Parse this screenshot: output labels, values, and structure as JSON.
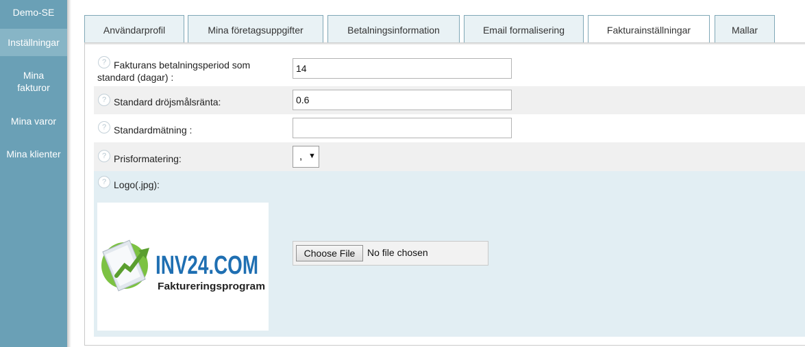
{
  "sidebar": {
    "title": "Demo-SE",
    "items": [
      {
        "label": "Inställningar",
        "active": true
      },
      {
        "label": "Mina fakturor",
        "active": false
      },
      {
        "label": "Mina varor",
        "active": false
      },
      {
        "label": "Mina klienter",
        "active": false
      }
    ]
  },
  "tabs": [
    {
      "label": "Användarprofil"
    },
    {
      "label": "Mina företagsuppgifter"
    },
    {
      "label": "Betalningsinformation"
    },
    {
      "label": "Email formalisering"
    },
    {
      "label": "Fakturainställningar",
      "active": true
    },
    {
      "label": "Mallar"
    }
  ],
  "form": {
    "help_glyph": "?",
    "payment_period": {
      "label": "Fakturans betalningsperiod som standard (dagar) :",
      "value": "14"
    },
    "interest": {
      "label": "Standard dröjsmålsränta:",
      "value": "0.6"
    },
    "measurement": {
      "label": "Standardmätning :",
      "value": ""
    },
    "price_format": {
      "label": "Prisformatering:",
      "value": ",",
      "arrow": "▼"
    },
    "logo": {
      "label": "Logo(.jpg):"
    },
    "file": {
      "button": "Choose File",
      "status": "No file chosen"
    }
  },
  "logo_image": {
    "brand": "INV24.COM",
    "tagline": "Faktureringsprogram"
  },
  "colors": {
    "sidebar": "#6aa0b6",
    "sidebar_active": "#87b5c6",
    "tab_bg": "#e9f2f5",
    "tab_border": "#7fa7b6",
    "row_alt": "#f0f0f0",
    "row_blue": "#e2eef3",
    "logo_green": "#7cc242",
    "logo_blue": "#1f6fb2"
  }
}
